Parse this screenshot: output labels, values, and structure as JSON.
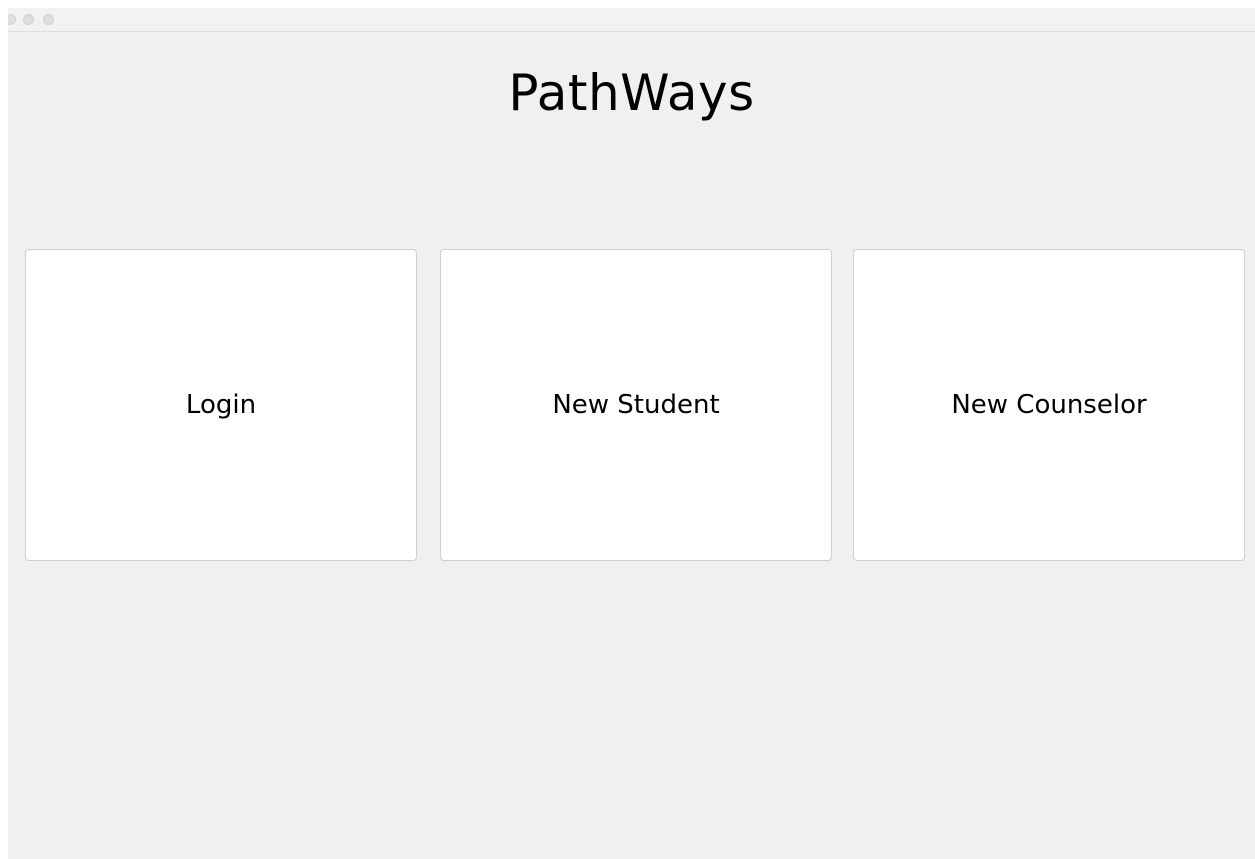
{
  "window": {
    "controls": [
      "close",
      "minimize",
      "maximize"
    ]
  },
  "app": {
    "title": "PathWays"
  },
  "options": [
    {
      "label": "Login"
    },
    {
      "label": "New Student"
    },
    {
      "label": "New Counselor"
    }
  ]
}
